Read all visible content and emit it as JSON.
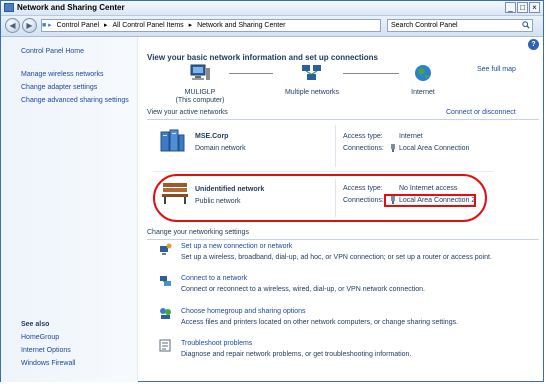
{
  "window": {
    "title": "Network and Sharing Center"
  },
  "address": {
    "crumbs": [
      "Control Panel",
      "All Control Panel Items",
      "Network and Sharing Center"
    ],
    "search_placeholder": "Search Control Panel"
  },
  "sidebar": {
    "home": "Control Panel Home",
    "links": [
      "Manage wireless networks",
      "Change adapter settings",
      "Change advanced sharing settings"
    ],
    "see_also_header": "See also",
    "see_also": [
      "HomeGroup",
      "Internet Options",
      "Windows Firewall"
    ]
  },
  "main": {
    "title": "View your basic network information and set up connections",
    "see_full_map": "See full map",
    "map": {
      "computer_name": "MULIGLP",
      "computer_sub": "(This computer)",
      "middle": "Multiple networks",
      "internet": "Internet"
    },
    "active_header": "View your active networks",
    "connect_disconnect": "Connect or disconnect",
    "networks": [
      {
        "name": "MSE.Corp",
        "type": "Domain network",
        "access_label": "Access type:",
        "access_value": "Internet",
        "conn_label": "Connections:",
        "conn_value": "Local Area Connection"
      },
      {
        "name": "Unidentified network",
        "type": "Public network",
        "access_label": "Access type:",
        "access_value": "No Internet access",
        "conn_label": "Connections:",
        "conn_value": "Local Area Connection 2"
      }
    ],
    "change_header": "Change your networking settings",
    "tasks": [
      {
        "link": "Set up a new connection or network",
        "desc": "Set up a wireless, broadband, dial-up, ad hoc, or VPN connection; or set up a router or access point."
      },
      {
        "link": "Connect to a network",
        "desc": "Connect or reconnect to a wireless, wired, dial-up, or VPN network connection."
      },
      {
        "link": "Choose homegroup and sharing options",
        "desc": "Access files and printers located on other network computers, or change sharing settings."
      },
      {
        "link": "Troubleshoot problems",
        "desc": "Diagnose and repair network problems, or get troubleshooting information."
      }
    ]
  },
  "colors": {
    "link": "#1f48a1",
    "text": "#1e395b",
    "highlight": "#e01010"
  }
}
